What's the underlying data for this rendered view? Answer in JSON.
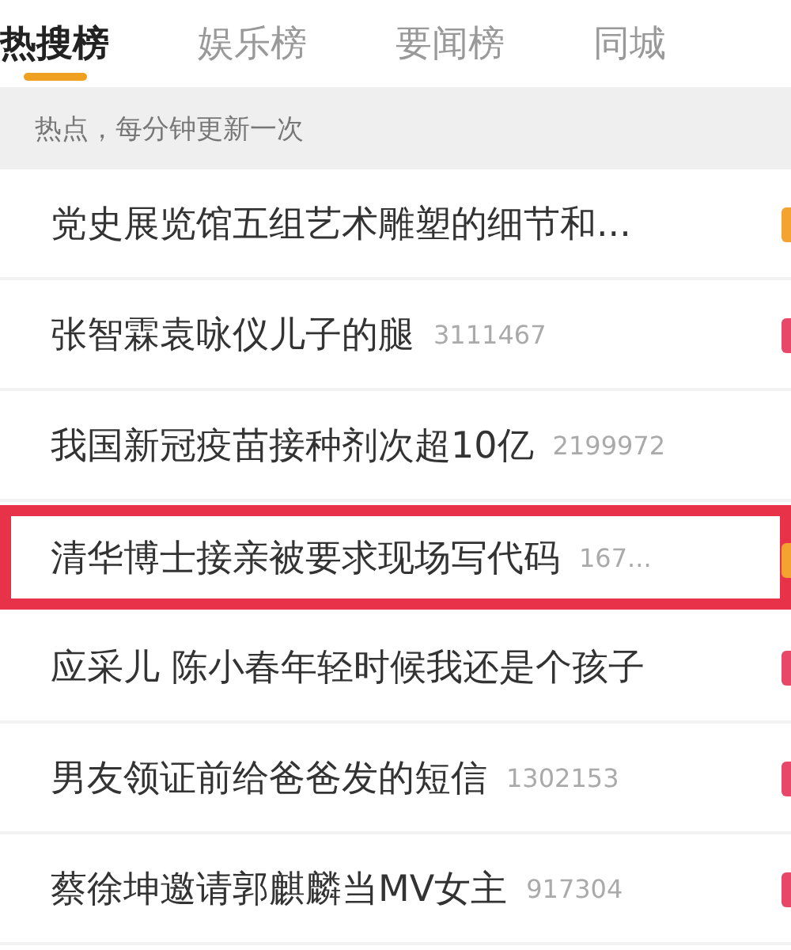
{
  "tabs": [
    {
      "label": "热搜榜",
      "selected": true
    },
    {
      "label": "娱乐榜",
      "selected": false
    },
    {
      "label": "要闻榜",
      "selected": false
    },
    {
      "label": "同城",
      "selected": false
    }
  ],
  "notice": "热点，每分钟更新一次",
  "items": [
    {
      "title": "党史展览馆五组艺术雕塑的细节和...",
      "color": "#f5a330",
      "highlighted": false
    },
    {
      "title": "张智霖袁咏仪儿子的腿",
      "count": "3111467",
      "color": "#e8476a",
      "highlighted": false
    },
    {
      "title": "我国新冠疫苗接种剂次超10亿",
      "count": "2199972",
      "highlighted": false
    },
    {
      "title": "清华博士接亲被要求现场写代码",
      "count": "167...",
      "color": "#f5a330",
      "highlighted": true
    },
    {
      "title": "应采儿 陈小春年轻时候我还是个孩子",
      "color": "#e8476a",
      "highlighted": false
    },
    {
      "title": "男友领证前给爸爸发的短信",
      "count": "1302153",
      "color": "#e8476a",
      "highlighted": false
    },
    {
      "title": "蔡徐坤邀请郭麒麟当MV女主",
      "count": "917304",
      "color": "#e8476a",
      "highlighted": false
    }
  ]
}
